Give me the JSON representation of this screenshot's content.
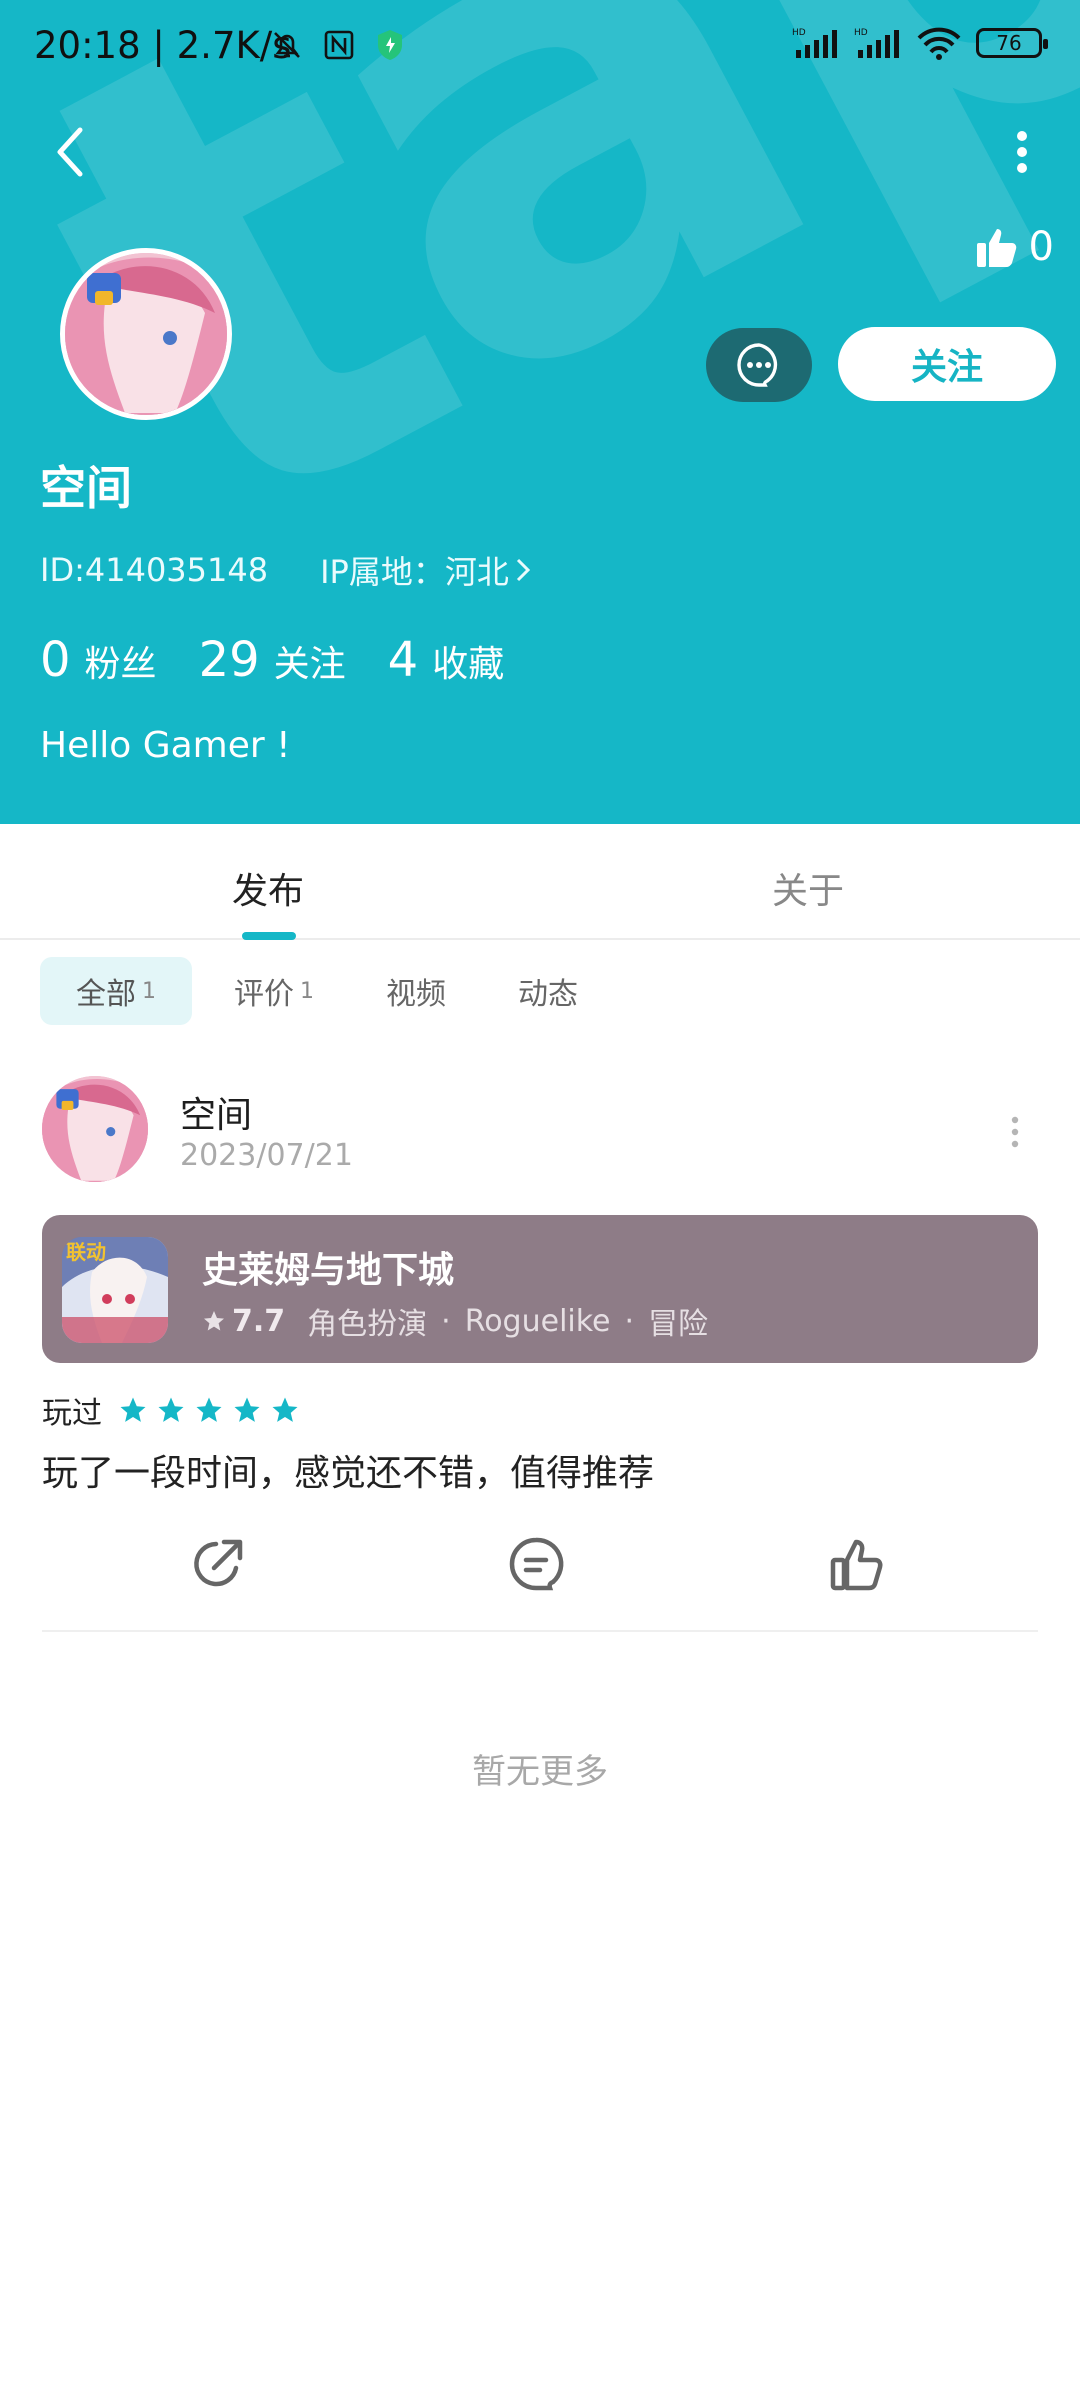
{
  "status_bar": {
    "time": "20:18",
    "speed": "2.7K/s",
    "battery": "76"
  },
  "header": {
    "likes_count": "0",
    "follow_label": "关注",
    "username": "空间",
    "id_text": "ID:414035148",
    "ip_text": "IP属地：河北",
    "watermark": "tap",
    "stats": [
      {
        "num": "0",
        "label": "粉丝"
      },
      {
        "num": "29",
        "label": "关注"
      },
      {
        "num": "4",
        "label": "收藏"
      }
    ],
    "bio": "Hello Gamer !"
  },
  "tabs": [
    {
      "label": "发布",
      "active": true
    },
    {
      "label": "关于",
      "active": false
    }
  ],
  "filters": [
    {
      "label": "全部",
      "count": "1",
      "active": true
    },
    {
      "label": "评价",
      "count": "1",
      "active": false
    },
    {
      "label": "视频",
      "count": "",
      "active": false
    },
    {
      "label": "动态",
      "count": "",
      "active": false
    }
  ],
  "post": {
    "author": "空间",
    "date": "2023/07/21",
    "game": {
      "title": "史莱姆与地下城",
      "score": "7.7",
      "tags": [
        "角色扮演",
        "Roguelike",
        "冒险"
      ],
      "badge": "联动"
    },
    "played_label": "玩过",
    "rating": 5,
    "text": "玩了一段时间，感觉还不错，值得推荐"
  },
  "footer": {
    "no_more": "暂无更多"
  },
  "colors": {
    "brand": "#15b7c7",
    "card": "#8e7c87",
    "message_button": "#1d6a72"
  }
}
